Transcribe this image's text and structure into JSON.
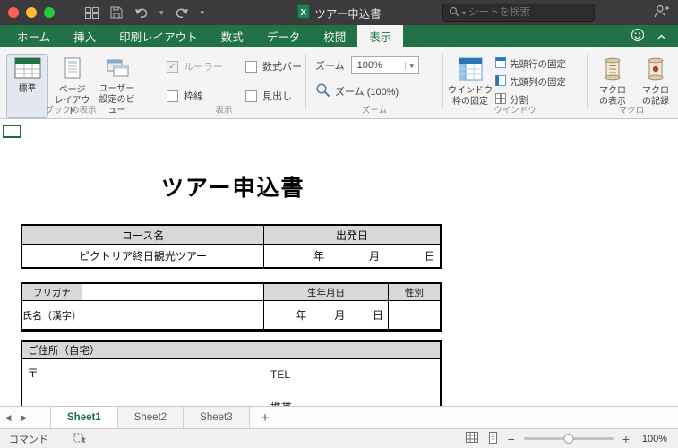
{
  "colors": {
    "ribbon_green": "#217346",
    "active_tab_text": "#1c6b41",
    "table_header_bg": "#d8d8d8"
  },
  "titlebar": {
    "title": "ツアー申込書",
    "search_placeholder": "シートを検索"
  },
  "ribbon_tabs": [
    {
      "label": "ホーム"
    },
    {
      "label": "挿入"
    },
    {
      "label": "印刷レイアウト"
    },
    {
      "label": "数式"
    },
    {
      "label": "データ"
    },
    {
      "label": "校閲"
    },
    {
      "label": "表示"
    }
  ],
  "ribbon": {
    "book_view_group": {
      "label": "ブックの表示",
      "normal": "標準",
      "page_layout": "ページ レイアウト",
      "custom_views": "ユーザー 設定のビュー"
    },
    "show_group": {
      "label": "表示",
      "ruler": "ルーラー",
      "formula_bar": "数式バー",
      "gridlines": "枠線",
      "headings": "見出し"
    },
    "zoom_group": {
      "label": "ズーム",
      "zoom_caption": "ズーム",
      "zoom_value": "100%",
      "zoom_100": "ズーム (100%)"
    },
    "window_group": {
      "label": "ウインドウ",
      "freeze_panes": "ウインドウ 枠の固定",
      "freeze_top_row": "先頭行の固定",
      "freeze_first_column": "先頭列の固定",
      "split": "分割"
    },
    "macro_group": {
      "label": "マクロ",
      "view_macros": "マクロ の表示",
      "record_macro": "マクロ の記録"
    }
  },
  "document": {
    "title": "ツアー申込書",
    "course_table": {
      "course_header": "コース名",
      "departure_header": "出発日",
      "course_value": "ピクトリア終日観光ツアー",
      "year": "年",
      "month": "月",
      "day": "日"
    },
    "name_table": {
      "furigana": "フリガナ",
      "birthdate": "生年月日",
      "gender": "性別",
      "name": "氏名（漢字）",
      "year": "年",
      "month": "月",
      "day": "日"
    },
    "address_table": {
      "header": "ご住所（自宅）",
      "postal": "〒",
      "tel": "TEL",
      "mobile": "携帯"
    }
  },
  "sheetbar": {
    "tabs": [
      {
        "label": "Sheet1"
      },
      {
        "label": "Sheet2"
      },
      {
        "label": "Sheet3"
      }
    ],
    "add": "+"
  },
  "statusbar": {
    "mode": "コマンド",
    "zoom": "100%"
  }
}
